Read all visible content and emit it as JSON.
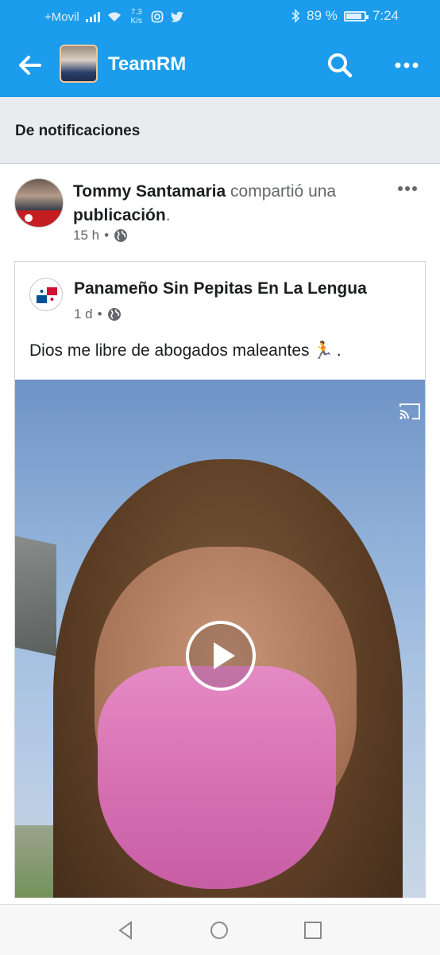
{
  "status_bar": {
    "carrier": "+Movil",
    "speed_value": "7.3",
    "speed_unit": "K/s",
    "battery_percent": "89 %",
    "time": "7:24"
  },
  "app_bar": {
    "title": "TeamRM",
    "icons": [
      "back-arrow-icon",
      "search-icon",
      "more-horizontal-icon"
    ]
  },
  "notifications_header": {
    "label": "De notificaciones"
  },
  "post": {
    "author": "Tommy Santamaria",
    "action": "compartió una",
    "object": "publicación",
    "period": ".",
    "time": "15 h",
    "separator": "•",
    "privacy_icon": "globe-icon",
    "shared": {
      "page_name": "Panameño Sin Pepitas En La Lengua",
      "time": "1 d",
      "separator": "•",
      "privacy_icon": "globe-icon",
      "text": "Dios me libre de abogados maleantes",
      "emoji": "🏃",
      "text_end": ".",
      "video": {
        "cast_icon": "cast-icon",
        "play_icon": "play-icon"
      }
    }
  },
  "system_nav": {
    "icons": [
      "nav-back-icon",
      "nav-home-icon",
      "nav-recents-icon"
    ]
  },
  "colors": {
    "brand_blue": "#1b9cec",
    "header_bg": "#e9ebee",
    "text_primary": "#1c1e21",
    "text_secondary": "#65676b"
  }
}
